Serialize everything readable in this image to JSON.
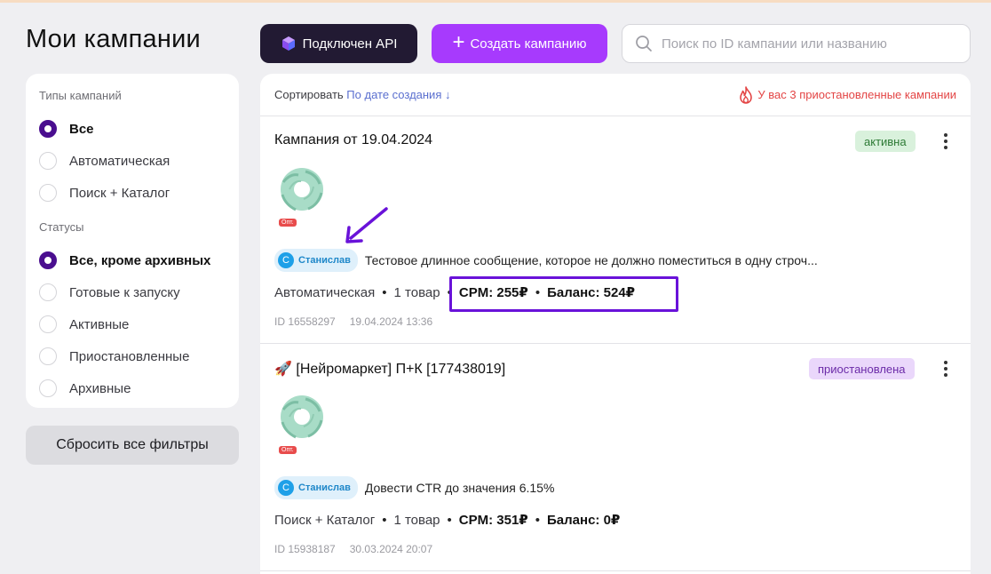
{
  "page": {
    "title": "Мои кампании"
  },
  "header": {
    "api_label": "Подключен API",
    "create_label": "Создать кампанию",
    "search_placeholder": "Поиск по ID кампании или названию"
  },
  "filters": {
    "types_heading": "Типы кампаний",
    "types": [
      {
        "label": "Все",
        "selected": true
      },
      {
        "label": "Автоматическая",
        "selected": false
      },
      {
        "label": "Поиск + Каталог",
        "selected": false
      }
    ],
    "statuses_heading": "Статусы",
    "statuses": [
      {
        "label": "Все, кроме архивных",
        "selected": true
      },
      {
        "label": "Готовые к запуску",
        "selected": false
      },
      {
        "label": "Активные",
        "selected": false
      },
      {
        "label": "Приостановленные",
        "selected": false
      },
      {
        "label": "Архивные",
        "selected": false
      }
    ],
    "reset_label": "Сбросить все фильтры"
  },
  "list": {
    "sort_label": "Сортировать",
    "sort_value": "По дате создания ↓",
    "paused_note": "У вас 3 приостановленные кампании",
    "campaigns": [
      {
        "title": "Кампания от 19.04.2024",
        "status": "активна",
        "tag": "Опт.",
        "author_initial": "С",
        "author": "Станислав",
        "message": "Тестовое длинное сообщение, которое не должно поместиться в одну строч...",
        "type": "Автоматическая",
        "items": "1 товар",
        "cpm": "CPM: 255₽",
        "balance": "Баланс: 524₽",
        "id": "ID 16558297",
        "date": "19.04.2024 13:36"
      },
      {
        "title": "🚀 [Нейромаркет] П+К [177438019]",
        "status": "приостановлена",
        "tag": "Опт.",
        "author_initial": "С",
        "author": "Станислав",
        "message": "Довести CTR до значения 6.15%",
        "type": "Поиск + Каталог",
        "items": "1 товар",
        "cpm": "CPM: 351₽",
        "balance": "Баланс: 0₽",
        "id": "ID 15938187",
        "date": "30.03.2024 20:07"
      }
    ]
  },
  "colors": {
    "accent": "#a73afd",
    "highlight": "#6912d9",
    "api_button": "#221a33",
    "danger": "#e34545"
  }
}
